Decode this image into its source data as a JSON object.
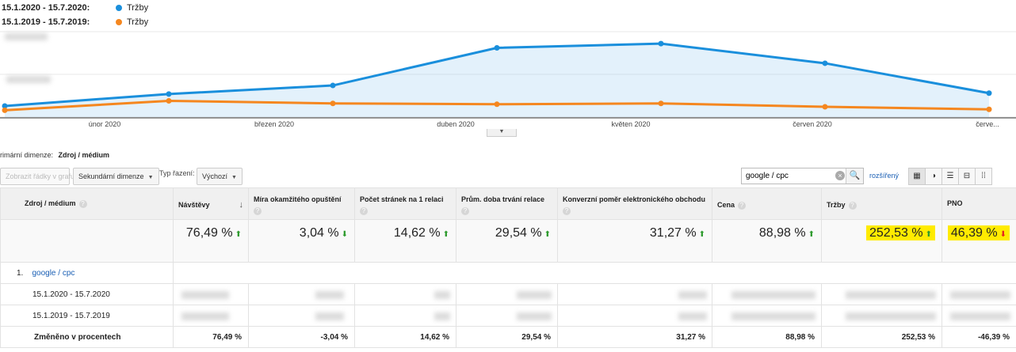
{
  "legend": [
    {
      "range": "15.1.2020 - 15.7.2020:",
      "series": "Tržby",
      "color": "#1a8fdc"
    },
    {
      "range": "15.1.2019 - 15.7.2019:",
      "series": "Tržby",
      "color": "#f5871f"
    }
  ],
  "chart_data": {
    "type": "line",
    "title": "",
    "xlabel": "",
    "ylabel": "",
    "x_labels": [
      "únor 2020",
      "březen 2020",
      "duben 2020",
      "květen 2020",
      "červen 2020",
      "červe..."
    ],
    "series": [
      {
        "name": "Tržby",
        "period": "15.1.2020 - 15.7.2020",
        "color": "#1a8fdc",
        "values": [
          0.13,
          0.27,
          0.37,
          0.81,
          0.86,
          0.63,
          0.28
        ]
      },
      {
        "name": "Tržby",
        "period": "15.1.2019 - 15.7.2019",
        "color": "#f5871f",
        "values": [
          0.08,
          0.19,
          0.16,
          0.15,
          0.16,
          0.12,
          0.09
        ]
      }
    ],
    "ylim": [
      0,
      1
    ],
    "grid": true,
    "area_fill_first_series": true,
    "y_axis_labels_redacted": true
  },
  "primary_dimension": {
    "label": "rimární dimenze:",
    "value": "Zdroj / médium"
  },
  "toolbar": {
    "plot_rows": "Zobrazit řádky v grafu",
    "secondary_dimension": "Sekundární dimenze",
    "sort_type_label": "Typ řazení:",
    "sort_type_value": "Výchozí",
    "search_value": "google / cpc",
    "advanced": "rozšířený"
  },
  "table": {
    "columns": [
      {
        "name": "Zdroj / médium",
        "help": "?"
      },
      {
        "name": "Návštěvy",
        "help": "?"
      },
      {
        "name": "Míra okamžitého opuštění",
        "help": "?"
      },
      {
        "name": "Počet stránek na 1 relaci",
        "help": "?"
      },
      {
        "name": "Prům. doba trvání relace",
        "help": "?"
      },
      {
        "name": "Konverzní poměr elektronického obchodu",
        "help": "?"
      },
      {
        "name": "Cena",
        "help": "?"
      },
      {
        "name": "Tržby",
        "help": "?"
      },
      {
        "name": "PNO",
        "help": ""
      }
    ],
    "summary": [
      {
        "value": "76,49 %",
        "trend": "up",
        "color": "#2e9b2e",
        "highlight": false
      },
      {
        "value": "3,04 %",
        "trend": "down",
        "color": "#2e9b2e",
        "highlight": false
      },
      {
        "value": "14,62 %",
        "trend": "up",
        "color": "#2e9b2e",
        "highlight": false
      },
      {
        "value": "29,54 %",
        "trend": "up",
        "color": "#2e9b2e",
        "highlight": false
      },
      {
        "value": "31,27 %",
        "trend": "up",
        "color": "#2e9b2e",
        "highlight": false
      },
      {
        "value": "88,98 %",
        "trend": "up",
        "color": "#2e9b2e",
        "highlight": false
      },
      {
        "value": "252,53 %",
        "trend": "up",
        "color": "#2e9b2e",
        "highlight": true
      },
      {
        "value": "46,39 %",
        "trend": "down",
        "color": "#e52121",
        "highlight": true
      }
    ],
    "group": {
      "index": "1.",
      "label": "google / cpc"
    },
    "rows": [
      {
        "label": "15.1.2020 - 15.7.2020"
      },
      {
        "label": "15.1.2019 - 15.7.2019"
      }
    ],
    "change_row": {
      "label": "Změněno v procentech",
      "values": [
        "76,49 %",
        "-3,04 %",
        "14,62 %",
        "29,54 %",
        "31,27 %",
        "88,98 %",
        "252,53 %",
        "-46,39 %"
      ]
    }
  }
}
